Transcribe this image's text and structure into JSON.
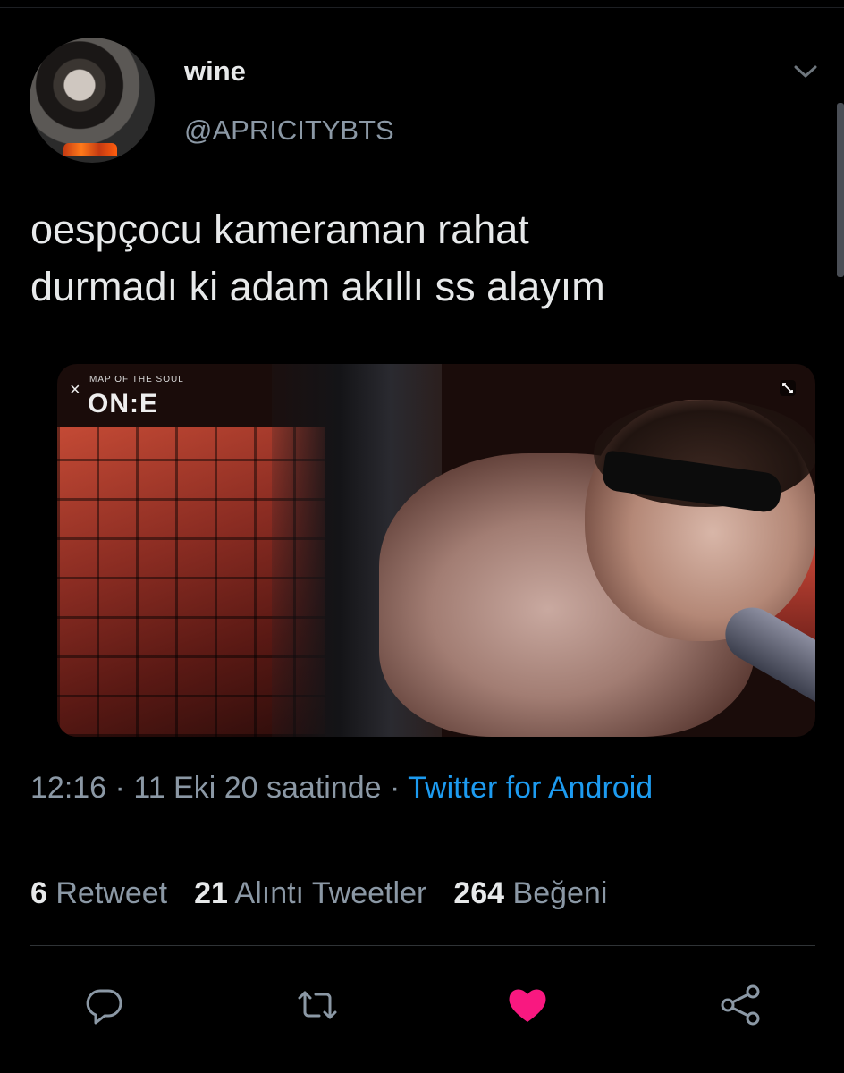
{
  "author": {
    "display_name": "wine",
    "handle": "@APRICITYBTS"
  },
  "tweet": {
    "text_line1": "oespçocu kameraman rahat",
    "text_line2": "durmadı ki adam akıllı ss alayım"
  },
  "media": {
    "overlay_small": "MAP OF THE SOUL",
    "overlay_logo": "ON:E",
    "close_glyph": "×"
  },
  "meta": {
    "time": "12:16",
    "separator": " · ",
    "date": "11 Eki 20 saatinde",
    "source": "Twitter for Android"
  },
  "stats": {
    "retweets_count": "6",
    "retweets_label": "Retweet",
    "quotes_count": "21",
    "quotes_label": "Alıntı Tweetler",
    "likes_count": "264",
    "likes_label": "Beğeni"
  },
  "icons": {
    "reply": "reply-icon",
    "retweet": "retweet-icon",
    "like": "heart-icon",
    "share": "share-icon",
    "more": "chevron-down-icon"
  },
  "colors": {
    "background": "#000000",
    "text_primary": "#e7e9ea",
    "text_secondary": "#8b98a5",
    "link": "#1d9bf0",
    "like": "#f91880"
  }
}
